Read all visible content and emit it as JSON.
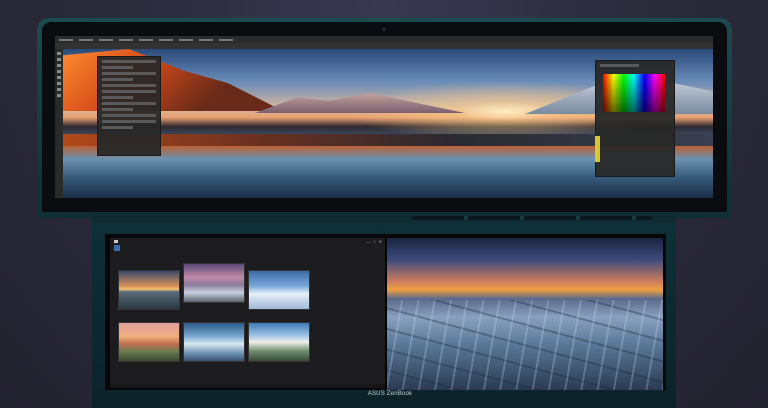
{
  "device": {
    "brand_label": "ASUS ZenBook"
  },
  "top_screen": {
    "app": "photo-editor",
    "panels": [
      "layers-panel",
      "color-picker-panel"
    ]
  },
  "screenpad": {
    "explorer": {
      "tabs": [
        "",
        "",
        "",
        ""
      ],
      "window_controls": [
        "—",
        "□",
        "✕"
      ]
    },
    "thumbnails": [
      "thumb-sunset-shore",
      "thumb-frozen-coast",
      "thumb-snow-dunes",
      "thumb-pink-sunrise",
      "thumb-ice-cave",
      "thumb-alpine-glacier"
    ]
  },
  "colors": {
    "lid": "#1d4a50",
    "deck": "#0f3038",
    "background": "#2a2838"
  }
}
